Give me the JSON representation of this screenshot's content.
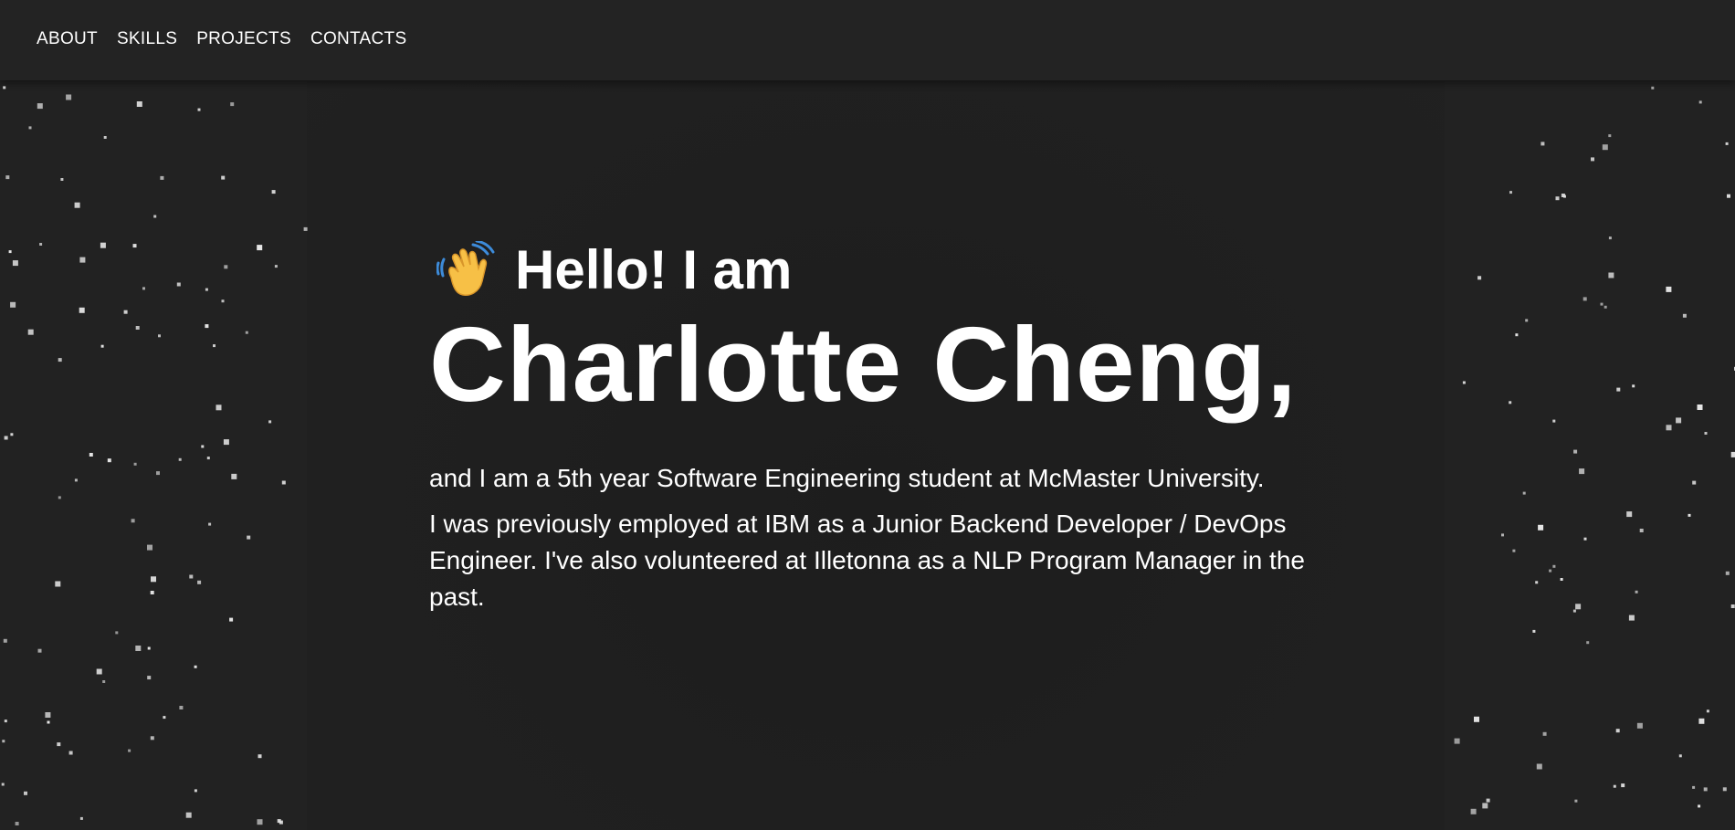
{
  "nav": {
    "items": [
      {
        "label": "ABOUT"
      },
      {
        "label": "SKILLS"
      },
      {
        "label": "PROJECTS"
      },
      {
        "label": "CONTACTS"
      }
    ]
  },
  "hero": {
    "greeting": "Hello! I am",
    "greeting_icon": "waving-hand-icon",
    "name": "Charlotte Cheng,",
    "paragraph_1": "and I am a 5th year Software Engineering student at McMaster University.",
    "paragraph_2": "I was previously employed at IBM as a Junior Backend Developer / DevOps Engineer. I've also volunteered at Illetonna as a NLP Program Manager in the past."
  },
  "colors": {
    "background": "#222222",
    "navbar": "#232323",
    "text": "#ffffff",
    "stars": "#e0e0e0"
  }
}
